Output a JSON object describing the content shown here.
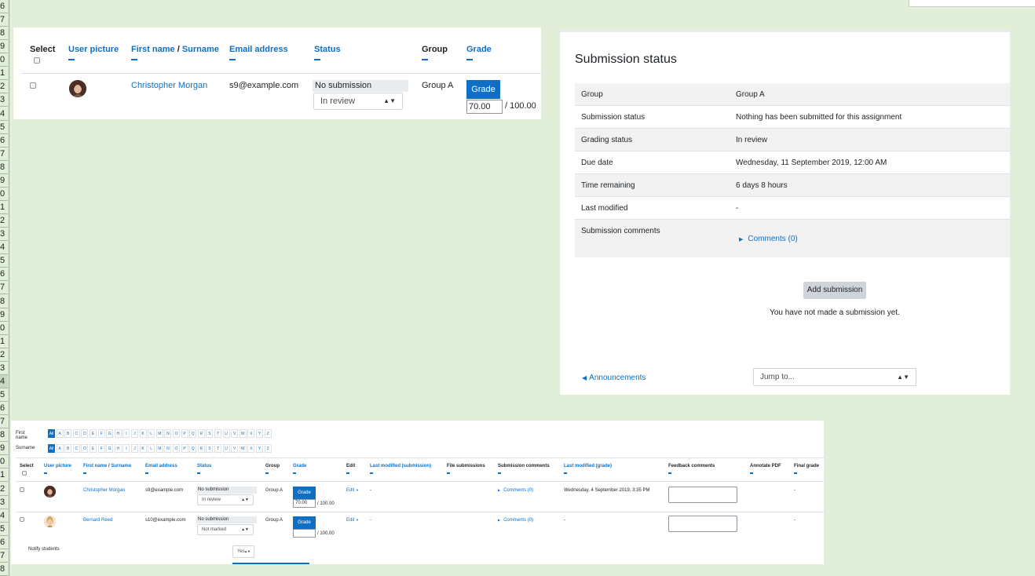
{
  "row_numbers": [
    "6",
    "7",
    "8",
    "9",
    "0",
    "1",
    "2",
    "3",
    "4",
    "5",
    "6",
    "7",
    "8",
    "9",
    "0",
    "1",
    "2",
    "3",
    "4",
    "5",
    "6",
    "7",
    "8",
    "9",
    "0",
    "1",
    "2",
    "3",
    "4",
    "5",
    "6",
    "7",
    "8",
    "9",
    "0",
    "1",
    "2",
    "3",
    "4",
    "5",
    "6",
    "7",
    "8"
  ],
  "panel1": {
    "headers": {
      "select": "Select",
      "user_picture": "User picture",
      "first_name": "First name",
      "slash": " / ",
      "surname": "Surname",
      "email": "Email address",
      "status": "Status",
      "group": "Group",
      "grade": "Grade"
    },
    "row": {
      "name": "Christopher Morgan",
      "email": "s9@example.com",
      "status": "No submission",
      "marking": "In review",
      "group": "Group A",
      "grade_button": "Grade",
      "grade_value": "70.00",
      "grade_max": "/ 100.00"
    }
  },
  "panel2": {
    "title": "Submission status",
    "rows": [
      {
        "label": "Group",
        "value": "Group A"
      },
      {
        "label": "Submission status",
        "value": "Nothing has been submitted for this assignment"
      },
      {
        "label": "Grading status",
        "value": "In review"
      },
      {
        "label": "Due date",
        "value": "Wednesday, 11 September 2019, 12:00 AM"
      },
      {
        "label": "Time remaining",
        "value": "6 days 8 hours"
      },
      {
        "label": "Last modified",
        "value": "-"
      },
      {
        "label": "Submission comments",
        "value": "Comments (0)"
      }
    ],
    "add_submission": "Add submission",
    "no_submission_note": "You have not made a submission yet.",
    "prev_link": "Announcements",
    "jump_to": "Jump to..."
  },
  "panel3": {
    "first_name_label": "First name",
    "surname_label": "Surname",
    "all": "All",
    "letters": [
      "A",
      "B",
      "C",
      "D",
      "E",
      "F",
      "G",
      "H",
      "I",
      "J",
      "K",
      "L",
      "M",
      "N",
      "O",
      "P",
      "Q",
      "R",
      "S",
      "T",
      "U",
      "V",
      "W",
      "X",
      "Y",
      "Z"
    ],
    "headers": {
      "select": "Select",
      "user_picture": "User picture",
      "first_name": "First name",
      "slash": " / ",
      "surname": "Surname",
      "email": "Email address",
      "status": "Status",
      "group": "Group",
      "grade": "Grade",
      "edit": "Edit",
      "last_modified_submission": "Last modified (submission)",
      "file_submissions": "File submissions",
      "submission_comments": "Submission comments",
      "last_modified_grade": "Last modified (grade)",
      "feedback_comments": "Feedback comments",
      "annotate_pdf": "Annotate PDF",
      "final_grade": "Final grade"
    },
    "rows": [
      {
        "name": "Christopher Morgan",
        "email": "s9@example.com",
        "status": "No submission",
        "marking": "In review",
        "group": "Group A",
        "grade_button": "Grade",
        "grade_value": "70.00",
        "grade_max": "/ 100.00",
        "edit": "Edit",
        "last_modified_submission": "-",
        "comments": "Comments (0)",
        "last_modified_grade": "Wednesday, 4 September 2019, 3:35 PM",
        "final_grade": "-"
      },
      {
        "name": "Bernard Reed",
        "email": "s10@example.com",
        "status": "No submission",
        "marking": "Not marked",
        "group": "Group A",
        "grade_button": "Grade",
        "grade_value": "",
        "grade_max": "/ 100.00",
        "edit": "Edit",
        "last_modified_submission": "-",
        "comments": "Comments (0)",
        "last_modified_grade": "-",
        "final_grade": "-"
      }
    ],
    "notify_students": "Notify students",
    "notify_value": "Yes"
  }
}
